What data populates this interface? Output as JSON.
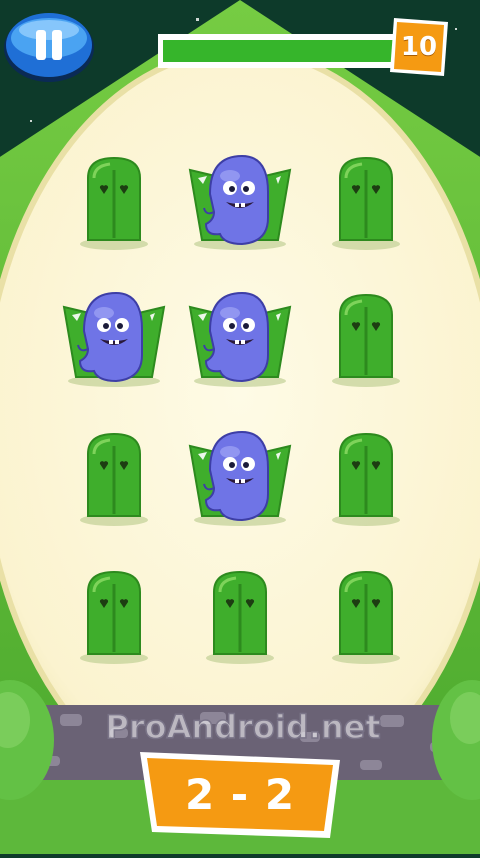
{
  "hud": {
    "pause_icon": "pause-icon",
    "progress_fraction": 0.95,
    "score": "10"
  },
  "board": {
    "rows": [
      [
        "tombstone",
        "ghost",
        "tombstone"
      ],
      [
        "ghost",
        "ghost",
        "tombstone"
      ],
      [
        "tombstone",
        "ghost",
        "tombstone"
      ],
      [
        "tombstone",
        "tombstone",
        "tombstone"
      ]
    ]
  },
  "footer": {
    "level": "2 - 2",
    "watermark": "ProAndroid.net"
  },
  "colors": {
    "sky": "#0d3a2a",
    "hill": "#5cb83a",
    "field": "#fdf8dd",
    "tomb": "#3fae2c",
    "ghost": "#6f74e6",
    "accent_orange": "#f59a12",
    "bar_green": "#36b52b"
  }
}
